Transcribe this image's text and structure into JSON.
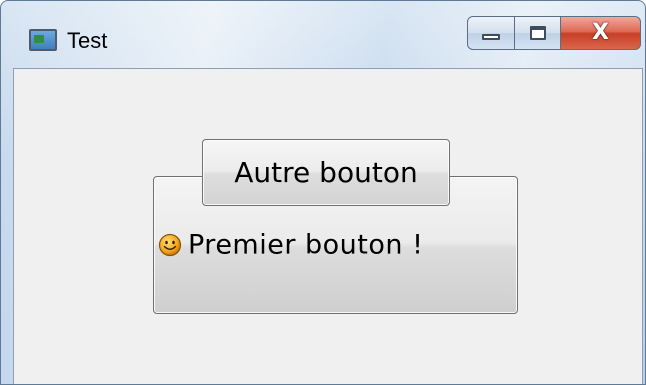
{
  "window": {
    "title": "Test",
    "app_icon": "window-app-icon",
    "controls": {
      "minimize_icon": "minimize-icon",
      "maximize_icon": "maximize-icon",
      "close_glyph": "X",
      "close_color": "#c83f26"
    }
  },
  "content": {
    "outer_button": {
      "icon": "smiley-icon",
      "label": "Premier bouton !",
      "visible_label_start": "P",
      "visible_label_end": "on !"
    },
    "inner_button": {
      "label": "Autre bouton"
    }
  }
}
